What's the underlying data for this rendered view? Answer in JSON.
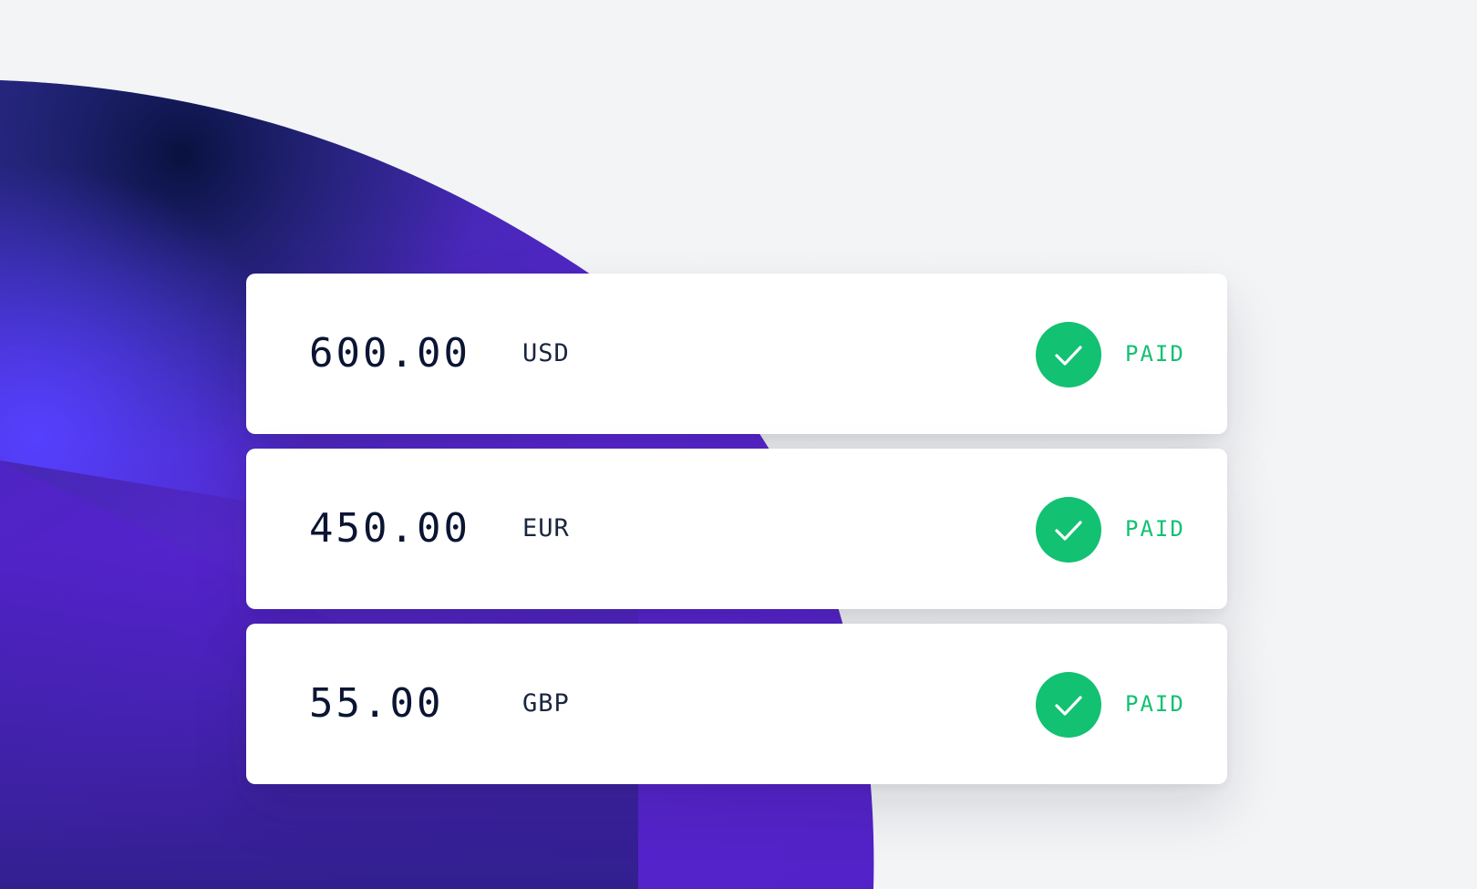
{
  "theme": {
    "background": "#f2f4f6",
    "accent_purple": "#5a2bd6",
    "accent_blue": "#4f3cff",
    "success_green": "#12c172",
    "text_dark": "#0b1533"
  },
  "payments": [
    {
      "amount": "600.00",
      "currency": "USD",
      "status": "PAID",
      "status_icon": "check-icon"
    },
    {
      "amount": "450.00",
      "currency": "EUR",
      "status": "PAID",
      "status_icon": "check-icon"
    },
    {
      "amount": "55.00",
      "currency": "GBP",
      "status": "PAID",
      "status_icon": "check-icon"
    }
  ]
}
